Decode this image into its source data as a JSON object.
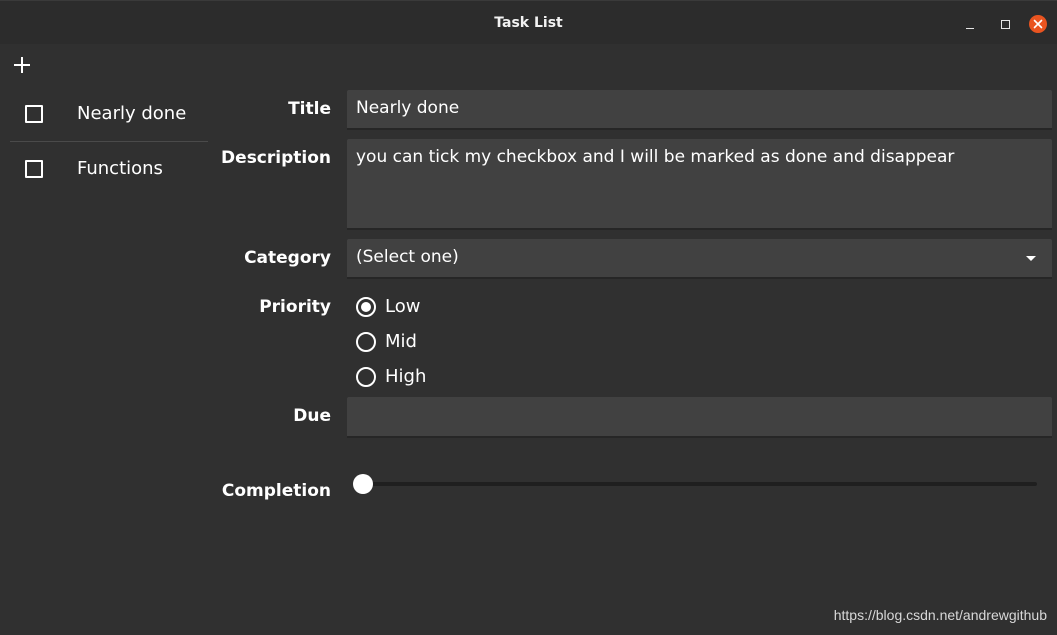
{
  "window": {
    "title": "Task List"
  },
  "sidebar": {
    "add_icon": "plus-icon",
    "tasks": [
      {
        "label": "Nearly done",
        "done": false
      },
      {
        "label": "Functions",
        "done": false
      }
    ]
  },
  "form": {
    "title_label": "Title",
    "title_value": "Nearly done",
    "description_label": "Description",
    "description_value": "you can tick my checkbox and I will be marked as done and disappear",
    "category_label": "Category",
    "category_value": "(Select one)",
    "priority_label": "Priority",
    "priority_options": [
      "Low",
      "Mid",
      "High"
    ],
    "priority_selected": "Low",
    "due_label": "Due",
    "due_value": "",
    "completion_label": "Completion",
    "completion_value": 0
  },
  "watermark": "https://blog.csdn.net/andrewgithub",
  "colors": {
    "close_button": "#e95420",
    "field_bg": "#414141",
    "window_bg": "#303030"
  }
}
